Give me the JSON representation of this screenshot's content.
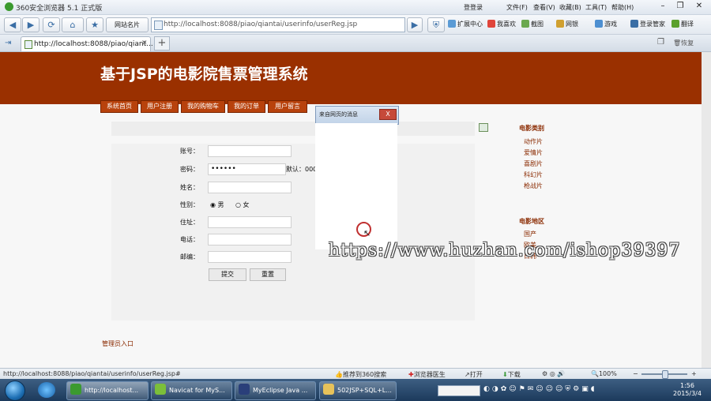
{
  "browser": {
    "title": "360安全浏览器 5.1 正式版",
    "menu": {
      "login": "登登录",
      "file": "文件(F)",
      "view": "查看(V)",
      "favorites": "收藏(B)",
      "tools": "工具(T)",
      "help": "帮助(H)"
    },
    "favorites_label": "网站名片",
    "address": "http://localhost:8088/piao/qiantai/userinfo/userReg.jsp",
    "toolbar": {
      "ext": "扩展中心",
      "fav": "我喜欢",
      "shot": "截图",
      "netbank": "网银",
      "game": "游戏",
      "login_mgr": "登录管家",
      "translate": "翻译"
    },
    "tab_title": "http://localhost:8088/piao/qiant...",
    "restore_label": "恢复",
    "status_url": "http://localhost:8088/piao/qiantai/userinfo/userReg.jsp#",
    "status": {
      "recommend": "推荐到360搜索",
      "doctor": "浏览器医生",
      "open": "打开",
      "download": "下载",
      "zoom": "100%"
    }
  },
  "page": {
    "banner_title": "基于JSP的电影院售票管理系统",
    "nav_tabs": [
      "系统首页",
      "用户注册",
      "我的购物车",
      "我的订单",
      "用户留言"
    ],
    "form": {
      "account_label": "账号：",
      "password_label": "密码：",
      "password_value": "••••••",
      "password_hint": "默认：000",
      "name_label": "姓名：",
      "gender_label": "性别：",
      "gender_male": "男",
      "gender_female": "女",
      "address_label": "住址：",
      "phone_label": "电话：",
      "email_label": "邮编：",
      "submit": "提交",
      "reset": "重置"
    },
    "admin_link": "管理员入口",
    "sidebar": {
      "category_title": "电影类别",
      "categories": [
        "动作片",
        "爱情片",
        "喜剧片",
        "科幻片",
        "枪战片"
      ],
      "region_title": "电影地区",
      "regions": [
        "国产",
        "欧美",
        "日韩"
      ]
    },
    "dialog_title": "来自网页的消息",
    "dialog_close": "X",
    "watermark": "https://www.huzhan.com/ishop39397"
  },
  "taskbar": {
    "tasks": [
      "http://localhost...",
      "Navicat for MyS...",
      "MyEclipse Java ...",
      "502JSP+SQL+L..."
    ],
    "time": "1:56",
    "date": "2015/3/4"
  }
}
